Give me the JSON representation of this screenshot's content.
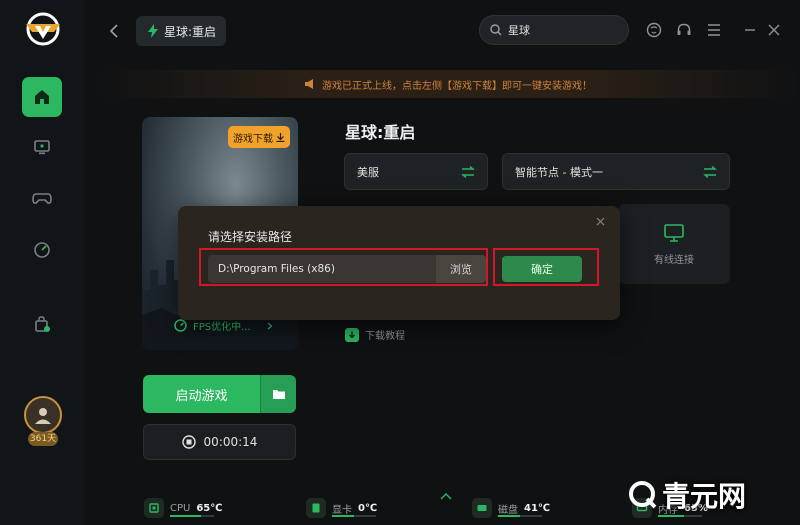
{
  "colors": {
    "accent": "#2bb861",
    "warning": "#d0823a",
    "badge": "#f0a22a",
    "highlight": "#d0182a"
  },
  "sidebar": {
    "items": [
      {
        "name": "home",
        "icon": "home-icon",
        "active": true
      },
      {
        "name": "monitor",
        "icon": "monitor-icon",
        "active": false
      },
      {
        "name": "gamepad",
        "icon": "gamepad-icon",
        "active": false
      },
      {
        "name": "speed",
        "icon": "speed-icon",
        "active": false
      },
      {
        "name": "bag",
        "icon": "bag-plus-icon",
        "active": false
      }
    ],
    "user_days": "361天"
  },
  "header": {
    "tab_label": "星球:重启",
    "search_value": "星球"
  },
  "notice": {
    "text": "游戏已正式上线，点击左侧【游戏下载】即可一键安装游戏！"
  },
  "game": {
    "download_badge": "游戏下载",
    "fps_label": "FPS优化中...",
    "title": "星球:重启",
    "server_select": "美服",
    "node_select": "智能节点 - 模式一",
    "wired_label": "有线连接",
    "tutorial_label": "下载教程",
    "start_button": "启动游戏",
    "timer": "00:00:14"
  },
  "modal": {
    "title": "请选择安装路径",
    "path_value": "D:\\Program Files (x86)",
    "browse_label": "浏览",
    "confirm_label": "确定"
  },
  "status": {
    "cpu_label": "CPU",
    "cpu_value": "65℃",
    "cpu_level": 0.7,
    "gpu_label": "显卡",
    "gpu_value": "0℃",
    "gpu_level": 0.5,
    "disk_label": "磁盘",
    "disk_value": "41℃",
    "disk_level": 0.5,
    "mem_label": "内存",
    "mem_value": "65%",
    "mem_level": 0.6
  },
  "watermark": {
    "text": "青元网"
  }
}
